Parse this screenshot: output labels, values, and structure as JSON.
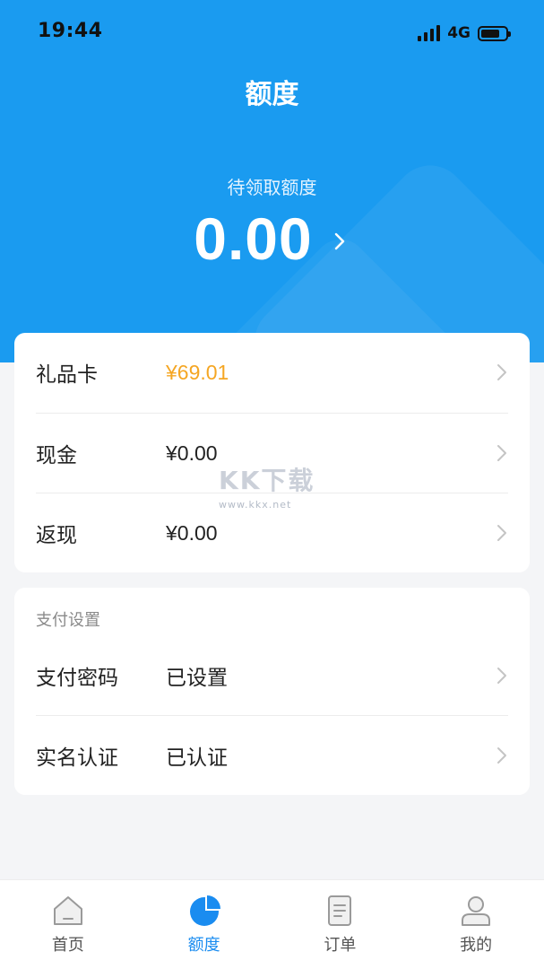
{
  "status_bar": {
    "time": "19:44",
    "network": "4G"
  },
  "header": {
    "title": "额度",
    "pending_label": "待领取额度",
    "pending_amount": "0.00"
  },
  "balances": [
    {
      "label": "礼品卡",
      "value": "¥69.01",
      "highlight_color": "#f5a623"
    },
    {
      "label": "现金",
      "value": "¥0.00"
    },
    {
      "label": "返现",
      "value": "¥0.00"
    }
  ],
  "payment_settings": {
    "section_title": "支付设置",
    "items": [
      {
        "label": "支付密码",
        "value": "已设置"
      },
      {
        "label": "实名认证",
        "value": "已认证"
      }
    ]
  },
  "watermark": {
    "logo": "KK下载",
    "url": "www.kkx.net"
  },
  "tabbar": {
    "tabs": [
      {
        "label": "首页",
        "icon": "home-icon"
      },
      {
        "label": "额度",
        "icon": "pie-chart-icon",
        "active": true
      },
      {
        "label": "订单",
        "icon": "document-icon"
      },
      {
        "label": "我的",
        "icon": "person-icon"
      }
    ]
  },
  "colors": {
    "brand_blue": "#1a9bf0",
    "tab_active": "#1a8cf0",
    "accent_orange": "#f5a623"
  }
}
